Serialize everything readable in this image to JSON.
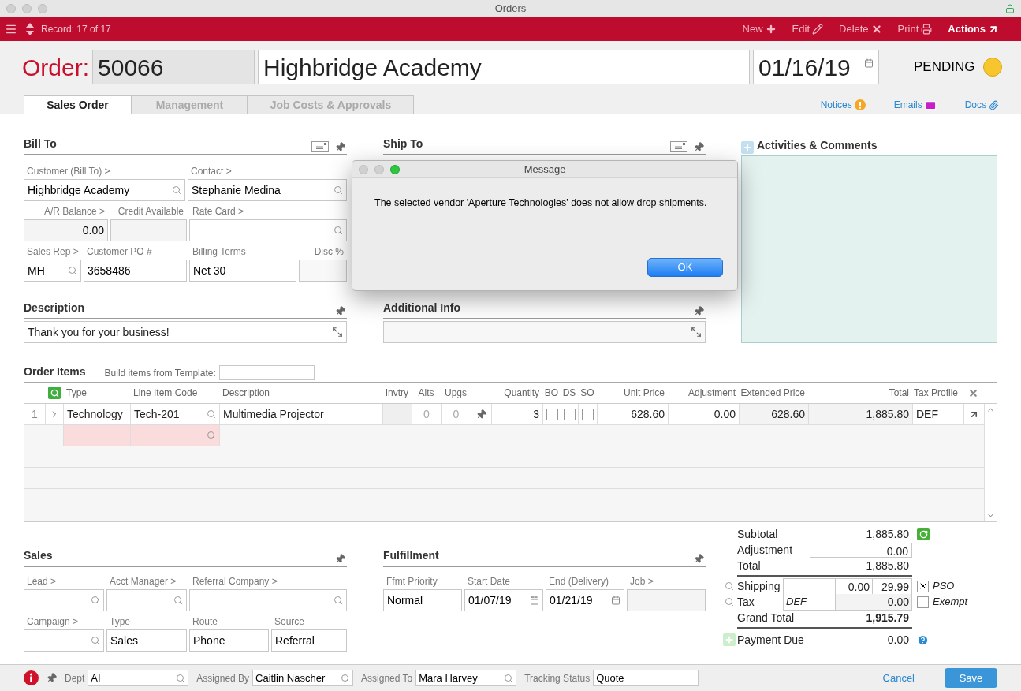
{
  "window": {
    "title": "Orders"
  },
  "toolbar": {
    "record": "Record: 17 of 17",
    "actions": [
      {
        "label": "New",
        "kind": "new",
        "highlighted": false
      },
      {
        "label": "Edit",
        "kind": "edit",
        "highlighted": false
      },
      {
        "label": "Delete",
        "kind": "delete",
        "highlighted": false
      },
      {
        "label": "Print",
        "kind": "print",
        "highlighted": false
      },
      {
        "label": "Actions",
        "kind": "actions",
        "highlighted": true
      }
    ]
  },
  "order": {
    "label": "Order:",
    "number": "50066",
    "customer": "Highbridge Academy",
    "date": "01/16/19",
    "status": "PENDING"
  },
  "tabs": [
    {
      "label": "Sales Order",
      "selected": true
    },
    {
      "label": "Management",
      "selected": false
    },
    {
      "label": "Job Costs & Approvals",
      "selected": false
    }
  ],
  "links": [
    {
      "label": "Notices",
      "kind": "notices"
    },
    {
      "label": "Emails",
      "kind": "emails"
    },
    {
      "label": "Docs",
      "kind": "docs"
    }
  ],
  "bill_to": {
    "title": "Bill To",
    "fields": [
      {
        "label": "Customer (Bill To) >",
        "value": "Highbridge Academy",
        "kind": "lookup"
      },
      {
        "label": "Contact >",
        "value": "Stephanie Medina",
        "kind": "lookup"
      },
      {
        "label": "A/R Balance >",
        "value": "0.00",
        "kind": "amount"
      },
      {
        "label": "Credit Available",
        "kind": "amount"
      },
      {
        "label": "Rate Card >",
        "kind": "lookup"
      },
      {
        "label": "Sales Rep >",
        "value": "MH",
        "kind": "lookup"
      },
      {
        "label": "Customer PO #",
        "value": "3658486",
        "kind": "text"
      },
      {
        "label": "Billing Terms",
        "value": "Net 30",
        "kind": "text"
      },
      {
        "label": "Disc %",
        "kind": "number"
      }
    ]
  },
  "description": {
    "title": "Description",
    "value": "Thank you for your business!"
  },
  "ship_to": {
    "title": "Ship To"
  },
  "additional_info": {
    "title": "Additional Info"
  },
  "activities": {
    "title": "Activities & Comments"
  },
  "order_items": {
    "title": "Order Items",
    "template_label": "Build items from Template:",
    "columns": [
      "Type",
      "Line Item Code",
      "Description",
      "Invtry",
      "Alts",
      "Upgs",
      "Quantity",
      "BO",
      "DS",
      "SO",
      "Unit Price",
      "Adjustment",
      "Extended Price",
      "Total",
      "Tax Profile"
    ],
    "rows": [
      {
        "number": "1",
        "type": "Technology",
        "code": "Tech-201",
        "description": "Multimedia Projector",
        "alts": "0",
        "upgs": "0",
        "quantity": "3",
        "bo": false,
        "ds": false,
        "so": false,
        "unit_price": "628.60",
        "adjustment": "0.00",
        "extended_price": "628.60",
        "total": "1,885.80",
        "tax_profile": "DEF"
      }
    ]
  },
  "sales": {
    "title": "Sales",
    "fields": [
      {
        "label": "Lead >",
        "kind": "lookup"
      },
      {
        "label": "Acct Manager >",
        "kind": "lookup"
      },
      {
        "label": "Referral Company >",
        "kind": "lookup"
      },
      {
        "label": "Campaign >",
        "kind": "lookup"
      },
      {
        "label": "Type",
        "value": "Sales",
        "kind": "text"
      },
      {
        "label": "Route",
        "value": "Phone",
        "kind": "text"
      },
      {
        "label": "Source",
        "value": "Referral",
        "kind": "text"
      }
    ]
  },
  "fulfillment": {
    "title": "Fulfillment",
    "fields": [
      {
        "label": "Ffmt Priority",
        "value": "Normal",
        "kind": "text"
      },
      {
        "label": "Start Date",
        "value": "01/07/19",
        "kind": "date"
      },
      {
        "label": "End (Delivery)",
        "value": "01/21/19",
        "kind": "date"
      },
      {
        "label": "Job >",
        "kind": "readonly"
      }
    ]
  },
  "totals": {
    "subtotal": {
      "label": "Subtotal",
      "value": "1,885.80"
    },
    "adjustment": {
      "label": "Adjustment",
      "value": "0.00"
    },
    "total": {
      "label": "Total",
      "value": "1,885.80"
    },
    "shipping": {
      "label": "Shipping",
      "cost": "0.00",
      "price": "29.99",
      "option": "PSO",
      "checked": true
    },
    "tax": {
      "label": "Tax",
      "profile": "DEF",
      "value": "0.00",
      "option": "Exempt",
      "checked": false
    },
    "grand_total": {
      "label": "Grand Total",
      "value": "1,915.79"
    },
    "payment_due": {
      "label": "Payment Due",
      "value": "0.00"
    }
  },
  "footer": {
    "fields": [
      {
        "label": "Dept",
        "value": "AI",
        "kind": "lookup"
      },
      {
        "label": "Assigned By",
        "value": "Caitlin Nascher",
        "kind": "lookup"
      },
      {
        "label": "Assigned To",
        "value": "Mara Harvey",
        "kind": "lookup"
      },
      {
        "label": "Tracking Status",
        "value": "Quote",
        "kind": "text"
      }
    ],
    "cancel": "Cancel",
    "save": "Save"
  },
  "dialog": {
    "title": "Message",
    "message": "The selected vendor 'Aperture Technologies' does not allow drop shipments.",
    "button": "OK"
  }
}
